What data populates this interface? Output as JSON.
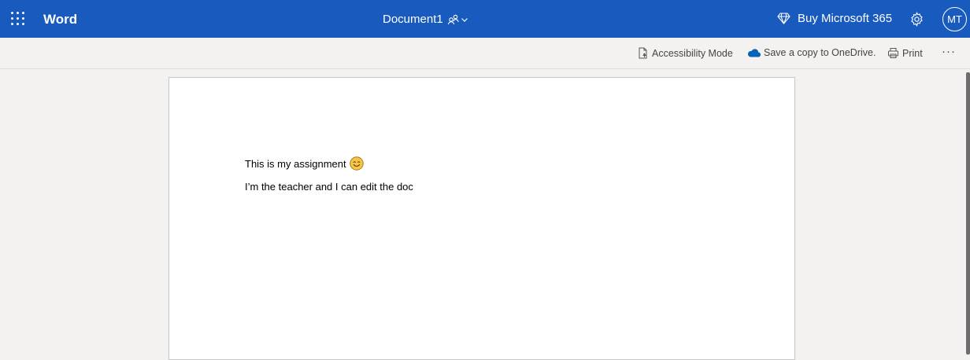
{
  "header": {
    "app_name": "Word",
    "doc_title": "Document1",
    "buy_label": "Buy Microsoft 365",
    "avatar_initials": "MT"
  },
  "toolbar": {
    "accessibility_label": "Accessibility Mode",
    "save_copy_label": "Save a copy to OneDrive.",
    "print_label": "Print",
    "more_label": "···"
  },
  "document": {
    "paragraphs": [
      "This is my assignment",
      "I’m the teacher and I can edit the doc"
    ]
  },
  "colors": {
    "header_bg": "#185abd",
    "toolbar_bg": "#f3f2f1",
    "page_bg": "#ffffff",
    "onedrive_blue": "#0364b8",
    "emoji_yellow": "#f7c548"
  }
}
